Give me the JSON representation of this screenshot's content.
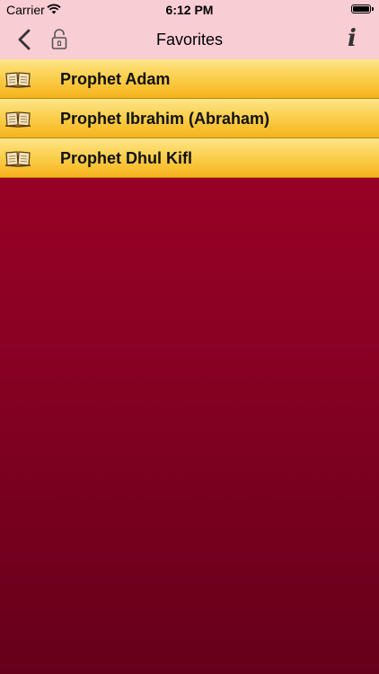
{
  "status_bar": {
    "carrier": "Carrier",
    "time": "6:12 PM",
    "wifi_icon": "wifi-icon",
    "battery_level": 1.0
  },
  "nav": {
    "title": "Favorites",
    "back_icon": "chevron-left-icon",
    "lock_icon": "lock-icon",
    "info_label": "i"
  },
  "favorites": [
    {
      "label": "Prophet Adam",
      "icon": "book-icon"
    },
    {
      "label": "Prophet Ibrahim (Abraham)",
      "icon": "book-icon"
    },
    {
      "label": "Prophet Dhul Kifl",
      "icon": "book-icon"
    }
  ],
  "colors": {
    "nav_background": "#f9cdd4",
    "list_gold": "#fbd04f",
    "content_maroon": "#8a0124"
  }
}
